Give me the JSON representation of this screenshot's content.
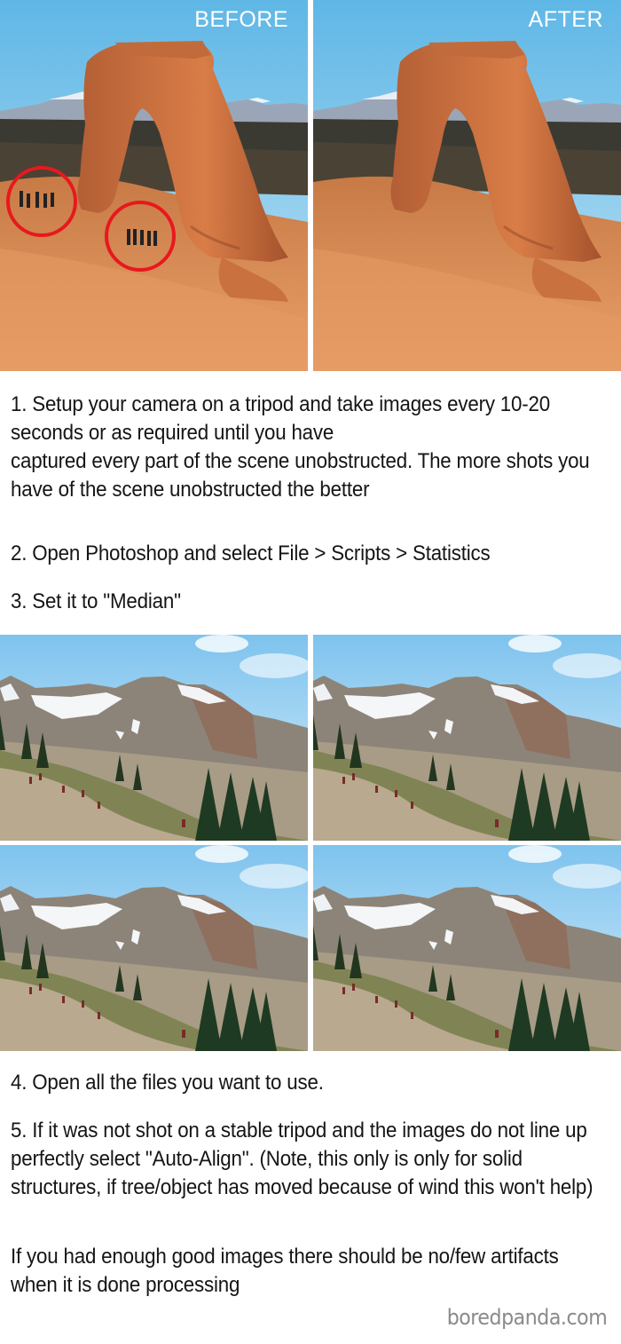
{
  "comparison": {
    "before_label": "BEFORE",
    "after_label": "AFTER",
    "before_alt": "Delicate Arch with tourists circled in red",
    "after_alt": "Delicate Arch with tourists removed",
    "highlight_color": "#e8181e"
  },
  "steps": [
    {
      "text": "1. Setup your camera on a tripod and take images every 10-20 seconds or as required until you have"
    },
    {
      "text": "captured every part of the scene unobstructed. The more shots you have of the scene unobstructed the better"
    },
    {
      "text": "2. Open Photoshop and select File > Scripts > Statistics"
    },
    {
      "text": "3. Set it to \"Median\""
    },
    {
      "text": "4. Open all the files you want to use."
    },
    {
      "text": "5. If it was not shot on a stable tripod and the images do not line up perfectly select \"Auto-Align\". (Note, this only is only for solid structures, if tree/object has moved because of wind this won't help)"
    },
    {
      "text": "If you had enough good images there should be no/few artifacts when it is done processing"
    }
  ],
  "sample_photos": [
    {
      "alt": "Mountain trail with hikers, frame 1"
    },
    {
      "alt": "Mountain trail with hikers, frame 2"
    },
    {
      "alt": "Mountain trail with hikers, frame 3"
    },
    {
      "alt": "Mountain trail with hikers, frame 4"
    }
  ],
  "watermark": "boredpanda.com"
}
